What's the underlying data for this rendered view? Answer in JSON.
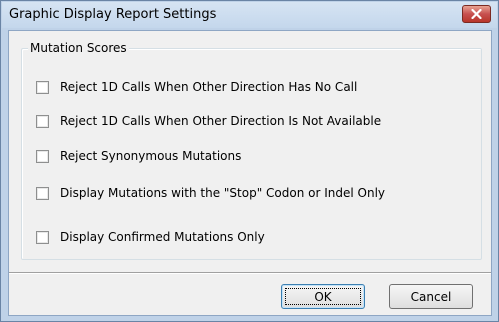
{
  "window": {
    "title": "Graphic Display Report Settings",
    "close_icon": "close-icon"
  },
  "group": {
    "label": "Mutation Scores",
    "options": [
      {
        "label": "Reject 1D Calls When Other Direction Has No Call",
        "checked": false
      },
      {
        "label": "Reject 1D Calls When Other Direction Is Not Available",
        "checked": false
      },
      {
        "label": "Reject Synonymous Mutations",
        "checked": false
      },
      {
        "label": "Display Mutations with the \"Stop\" Codon or Indel Only",
        "checked": false
      },
      {
        "label": "Display Confirmed Mutations Only",
        "checked": false
      }
    ]
  },
  "buttons": {
    "ok_label": "OK",
    "cancel_label": "Cancel"
  },
  "colors": {
    "frame": "#bfd2e8",
    "close_button": "#c75050",
    "dialog_background": "#f0f0f0"
  }
}
